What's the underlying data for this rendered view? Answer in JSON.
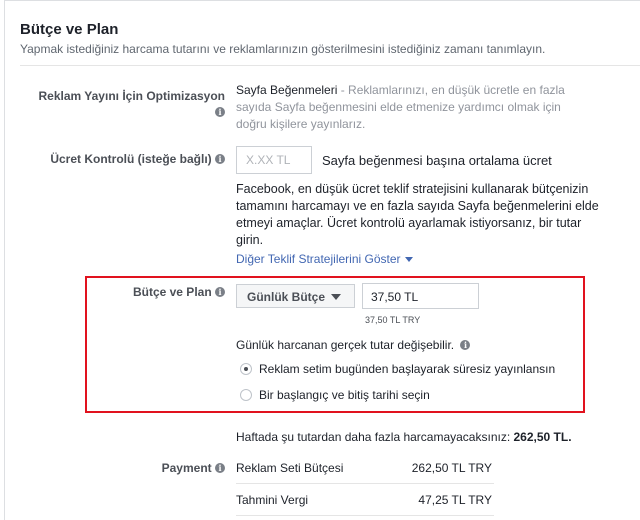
{
  "header": {
    "title": "Bütçe ve Plan",
    "subtitle": "Yapmak istediğiniz harcama tutarını ve reklamlarınızın gösterilmesini istediğiniz zamanı tanımlayın."
  },
  "optimization": {
    "label": "Reklam Yayını İçin Optimizasyon",
    "value": "Sayfa Beğenmeleri",
    "desc_line1": " - Reklamlarınızı, en düşük ücretle en fazla",
    "desc_line2": "sayıda Sayfa beğenmesini elde etmenize yardımcı olmak için",
    "desc_line3": "doğru kişilere yayınlarız."
  },
  "bid_control": {
    "label": "Ücret Kontrolü (isteğe bağlı)",
    "placeholder": "X.XX TL",
    "suffix": "Sayfa beğenmesi başına ortalama ücret",
    "desc_line1": "Facebook, en düşük ücret teklif stratejisini kullanarak bütçenizin",
    "desc_line2": "tamamını harcamayı ve en fazla sayıda Sayfa beğenmelerini elde",
    "desc_line3": "etmeyi amaçlar. Ücret kontrolü ayarlamak istiyorsanız, bir tutar",
    "desc_line4": "girin.",
    "link": "Diğer Teklif Stratejilerini Göster"
  },
  "budget": {
    "label": "Bütçe ve Plan",
    "dropdown": "Günlük Bütçe",
    "value": "37,50 TL",
    "hint": "37,50 TL TRY",
    "note": "Günlük harcanan gerçek tutar değişebilir.",
    "options": [
      {
        "label": "Reklam setim bugünden başlayarak süresiz yayınlansın",
        "selected": true
      },
      {
        "label": "Bir başlangıç ve bitiş tarihi seçin",
        "selected": false
      }
    ]
  },
  "weekly": {
    "text": "Haftada şu tutardan daha fazla harcamayacaksınız: ",
    "amount": "262,50 TL."
  },
  "payment": {
    "label": "Payment",
    "rows": [
      {
        "name": "Reklam Seti Bütçesi",
        "value": "262,50 TL TRY"
      },
      {
        "name": "Tahmini Vergi",
        "value": "47,25 TL TRY"
      }
    ]
  },
  "colors": {
    "highlight_border": "#e1121e",
    "link": "#4267b2"
  }
}
